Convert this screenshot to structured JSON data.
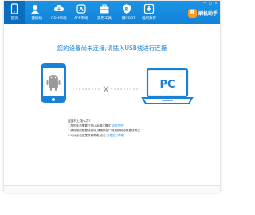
{
  "nav": {
    "items": [
      {
        "label": "首页",
        "icon": "phone-home-icon",
        "active": true
      },
      {
        "label": "一键刷机",
        "icon": "user-flash-icon"
      },
      {
        "label": "ROM市场",
        "icon": "cloud-download-icon"
      },
      {
        "label": "APP市场",
        "icon": "app-market-icon"
      },
      {
        "label": "实用工具",
        "icon": "toolbox-icon"
      },
      {
        "label": "一键ROOT",
        "icon": "root-shield-icon"
      },
      {
        "label": "线刷救砖",
        "icon": "plus-tools-icon"
      }
    ]
  },
  "brand": {
    "badge": "R",
    "name": "刷机助手"
  },
  "window_controls": [
    "—",
    "□",
    "×"
  ],
  "main": {
    "headline": "您的设备尚未连接,请插入USB线进行连接",
    "pc_label": "PC",
    "tips": {
      "title": "连接不上,怎么办?",
      "lines": [
        {
          "text": "1.您的手机需要打开USB调试模式",
          "link": "如何打开?"
        },
        {
          "text": "2.确保您的数据线完好,请更换接口或更换其他数据线再试",
          "link": ""
        },
        {
          "text": "3.可以点击这里获取帮助,点击",
          "link": "去看进行帮助"
        }
      ]
    }
  },
  "colors": {
    "accent": "#1a82d6",
    "navbar": "#1183d8",
    "brand_badge": "#ff9c1a"
  }
}
